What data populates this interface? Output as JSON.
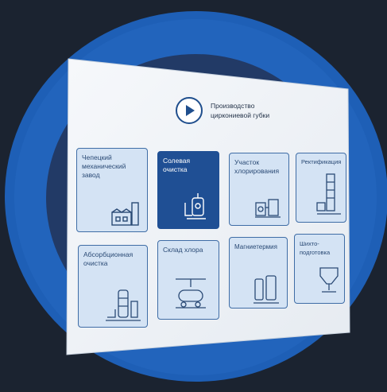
{
  "header": {
    "title_line1": "Производство",
    "title_line2": "циркониевой губки",
    "play_icon": "play-icon"
  },
  "tiles": [
    {
      "label": "Чепецкий механический завод",
      "icon": "factory-icon"
    },
    {
      "label": "Солевая очистка",
      "icon": "reactor-icon",
      "active": true
    },
    {
      "label": "Участок хлорирования",
      "icon": "chlorination-unit-icon"
    },
    {
      "label": "Ректификация",
      "icon": "distillation-column-icon"
    },
    {
      "label": "Абсорбционная очистка",
      "icon": "absorption-column-icon"
    },
    {
      "label": "Склад хлора",
      "icon": "chlorine-tank-icon"
    },
    {
      "label": "Магниетермия",
      "icon": "furnace-icon"
    },
    {
      "label": "Шихто-подготовка",
      "icon": "hopper-icon"
    }
  ],
  "colors": {
    "accent": "#1f4f94",
    "tile_bg": "#d4e3f4",
    "tile_border": "#3f6da6",
    "ring": "#1e5fb6",
    "background": "#1b2330"
  }
}
